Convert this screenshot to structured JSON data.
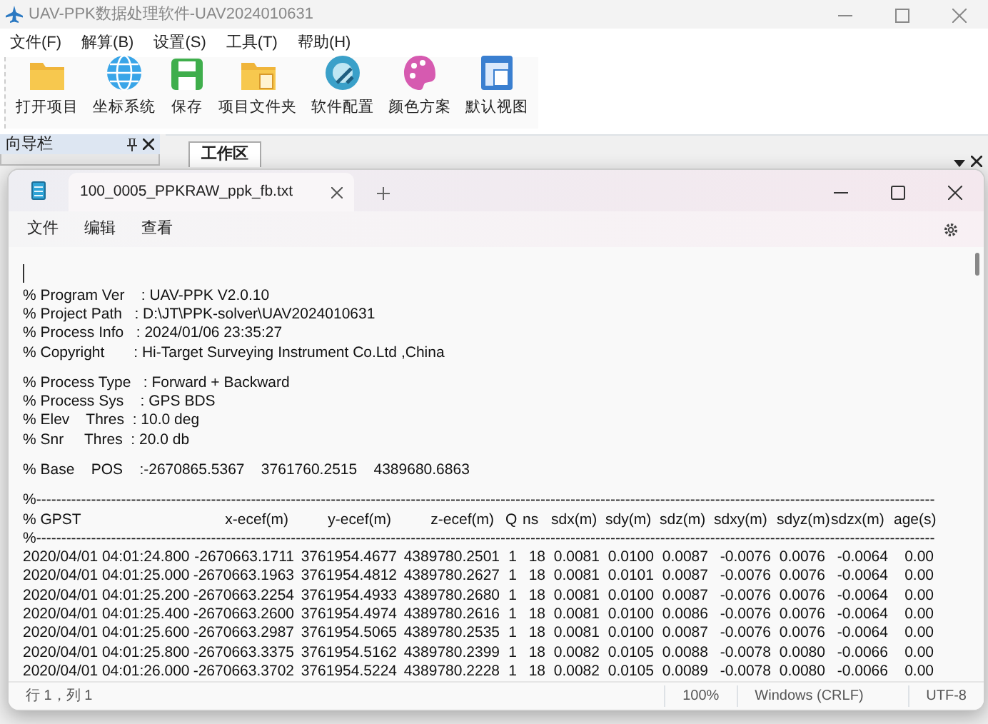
{
  "app": {
    "title": "UAV-PPK数据处理软件-UAV2024010631",
    "menu": [
      "文件(F)",
      "解算(B)",
      "设置(S)",
      "工具(T)",
      "帮助(H)"
    ],
    "toolbar": [
      {
        "label": "打开项目",
        "kind": "folder"
      },
      {
        "label": "坐标系统",
        "kind": "globe"
      },
      {
        "label": "保存",
        "kind": "save"
      },
      {
        "label": "项目文件夹",
        "kind": "folderdoc"
      },
      {
        "label": "软件配置",
        "kind": "config"
      },
      {
        "label": "颜色方案",
        "kind": "palette"
      },
      {
        "label": "默认视图",
        "kind": "view"
      }
    ],
    "nav_panel": {
      "title": "向导栏"
    },
    "workspace": {
      "tab": "工作区"
    }
  },
  "editor": {
    "tab": {
      "label": "100_0005_PPKRAW_ppk_fb.txt"
    },
    "menu": [
      "文件",
      "编辑",
      "查看"
    ],
    "header_blocks": [
      [
        "% Program Ver    : UAV-PPK V2.0.10",
        "% Project Path   : D:\\JT\\PPK-solver\\UAV2024010631",
        "% Process Info   : 2024/01/06 23:35:27",
        "% Copyright       : Hi-Target Surveying Instrument Co.Ltd ,China"
      ],
      [
        "% Process Type   : Forward + Backward",
        "% Process Sys    : GPS BDS",
        "% Elev    Thres  : 10.0 deg",
        "% Snr     Thres  : 20.0 db"
      ],
      [
        "% Base    POS    :-2670865.5367    3761760.2515    4389680.6863"
      ]
    ],
    "rule": "%------------------------------------------------------------------------------------------------------------------------------------------------------------------------------------",
    "columns": [
      "%  GPST",
      "x-ecef(m)",
      "y-ecef(m)",
      "z-ecef(m)",
      "Q",
      "ns",
      "sdx(m)",
      "sdy(m)",
      "sdz(m)",
      "sdxy(m)",
      "sdyz(m)",
      "sdzx(m)",
      "age(s)"
    ],
    "rows": [
      [
        "2020/04/01 04:01:24.800",
        "-2670663.1711",
        "3761954.4677",
        "4389780.2501",
        "1",
        "18",
        "0.0081",
        "0.0100",
        "0.0087",
        "-0.0076",
        "0.0076",
        "-0.0064",
        "0.00"
      ],
      [
        "2020/04/01 04:01:25.000",
        "-2670663.1963",
        "3761954.4812",
        "4389780.2627",
        "1",
        "18",
        "0.0081",
        "0.0101",
        "0.0087",
        "-0.0076",
        "0.0076",
        "-0.0064",
        "0.00"
      ],
      [
        "2020/04/01 04:01:25.200",
        "-2670663.2254",
        "3761954.4933",
        "4389780.2680",
        "1",
        "18",
        "0.0081",
        "0.0100",
        "0.0087",
        "-0.0076",
        "0.0076",
        "-0.0064",
        "0.00"
      ],
      [
        "2020/04/01 04:01:25.400",
        "-2670663.2600",
        "3761954.4974",
        "4389780.2616",
        "1",
        "18",
        "0.0081",
        "0.0100",
        "0.0086",
        "-0.0076",
        "0.0076",
        "-0.0064",
        "0.00"
      ],
      [
        "2020/04/01 04:01:25.600",
        "-2670663.2987",
        "3761954.5065",
        "4389780.2535",
        "1",
        "18",
        "0.0081",
        "0.0100",
        "0.0087",
        "-0.0076",
        "0.0076",
        "-0.0064",
        "0.00"
      ],
      [
        "2020/04/01 04:01:25.800",
        "-2670663.3375",
        "3761954.5162",
        "4389780.2399",
        "1",
        "18",
        "0.0082",
        "0.0105",
        "0.0088",
        "-0.0078",
        "0.0080",
        "-0.0066",
        "0.00"
      ],
      [
        "2020/04/01 04:01:26.000",
        "-2670663.3702",
        "3761954.5224",
        "4389780.2228",
        "1",
        "18",
        "0.0082",
        "0.0105",
        "0.0089",
        "-0.0078",
        "0.0080",
        "-0.0066",
        "0.00"
      ]
    ],
    "status": [
      "行 1，列 1",
      "100%",
      "Windows (CRLF)",
      "UTF-8"
    ]
  }
}
